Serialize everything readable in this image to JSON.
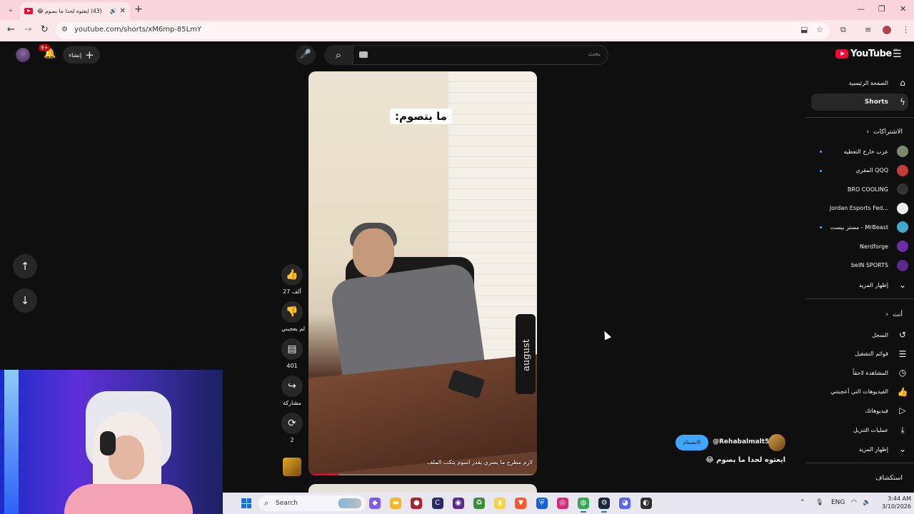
{
  "browser": {
    "tab_title": "(43) ايعتوه لحدا ما بصوم 😂",
    "url": "youtube.com/shorts/xM6mp-85LmY"
  },
  "header": {
    "notifications_badge": "9+",
    "create_label": "إنشاء",
    "search_placeholder": "بحث",
    "logo_text": "YouTube",
    "logo_country": "JO"
  },
  "sidebar": {
    "home": "الصفحة الرئيسية",
    "shorts": "Shorts",
    "subscriptions_header": "الاشتراكات",
    "subscriptions": [
      {
        "name": "عرب خارج التغطيه",
        "color": "#7d8a6a",
        "live": true
      },
      {
        "name": "المقري QQQ",
        "color": "#c53a3a",
        "live": true
      },
      {
        "name": "BRO COOLING",
        "color": "#333333",
        "live": false
      },
      {
        "name": "Jordan Esports Fed...",
        "color": "#eeeeee",
        "live": false
      },
      {
        "name": "مستر بيست - MrBeast",
        "color": "#3fa9c9",
        "live": true
      },
      {
        "name": "Nerdforge",
        "color": "#6a2fa6",
        "live": false
      },
      {
        "name": "beIN SPORTS",
        "color": "#5a2a8a",
        "live": false
      }
    ],
    "show_more_1": "إظهار المزيد",
    "you_header": "أنت",
    "you_items": [
      {
        "label": "السجل",
        "icon": "history-icon",
        "glyph": "↺"
      },
      {
        "label": "قوائم التشغيل",
        "icon": "playlists-icon",
        "glyph": "☰"
      },
      {
        "label": "المشاهدة لاحقاً",
        "icon": "clock-icon",
        "glyph": "◷"
      },
      {
        "label": "الفيديوهات التي أعجبتني",
        "icon": "like-icon",
        "glyph": "👍"
      },
      {
        "label": "فيديوهاتك",
        "icon": "your-videos-icon",
        "glyph": "▷"
      },
      {
        "label": "عمليات التنزيل",
        "icon": "download-icon",
        "glyph": "⤓"
      }
    ],
    "show_more_2": "إظهار المزيد",
    "explore_header": "استكشاف"
  },
  "short": {
    "caption": "ما بتصوم:",
    "subtitle": "لازم مطرح ما يسري يقدر اسوم يتكب الملف",
    "mug_text": "august",
    "progress": 0.13,
    "likes": "27 ألف",
    "dislike_label": "لم يعجبني",
    "comments": "401",
    "share_label": "مشاركة",
    "remix_count": "2",
    "channel_name": "@Rehabalmalt54",
    "join_label": "الانضمام",
    "title": "ايعتوه لحدا ما بصوم 😂"
  },
  "taskbar": {
    "search_label": "Search",
    "lang": "ENG",
    "time": "3:44 AM",
    "date": "3/10/2026",
    "apps": [
      {
        "icon": "copilot-icon",
        "color": "#7b5cf0",
        "glyph": "◆"
      },
      {
        "icon": "file-explorer-icon",
        "color": "#f2b72a",
        "glyph": "▬"
      },
      {
        "icon": "app-red-icon",
        "color": "#b01f2c",
        "glyph": "●"
      },
      {
        "icon": "app-c-icon",
        "color": "#2a2a6a",
        "glyph": "C"
      },
      {
        "icon": "app-purple-icon",
        "color": "#5b2a8c",
        "glyph": "◉"
      },
      {
        "icon": "app-green-icon",
        "color": "#3a8f3a",
        "glyph": "♻"
      },
      {
        "icon": "app-duck-icon",
        "color": "#f3d34a",
        "glyph": "◖"
      },
      {
        "icon": "brave-icon",
        "color": "#fb542b",
        "glyph": "▼"
      },
      {
        "icon": "bitwarden-icon",
        "color": "#175ddc",
        "glyph": "⛨"
      },
      {
        "icon": "instagram-icon",
        "color": "#d62976",
        "glyph": "◎"
      },
      {
        "icon": "chrome-icon",
        "color": "#34a853",
        "glyph": "◍"
      },
      {
        "icon": "steam-icon",
        "color": "#1b2838",
        "glyph": "⚙"
      },
      {
        "icon": "discord-icon",
        "color": "#5865f2",
        "glyph": "◕"
      },
      {
        "icon": "obs-icon",
        "color": "#302e31",
        "glyph": "◐"
      }
    ]
  }
}
